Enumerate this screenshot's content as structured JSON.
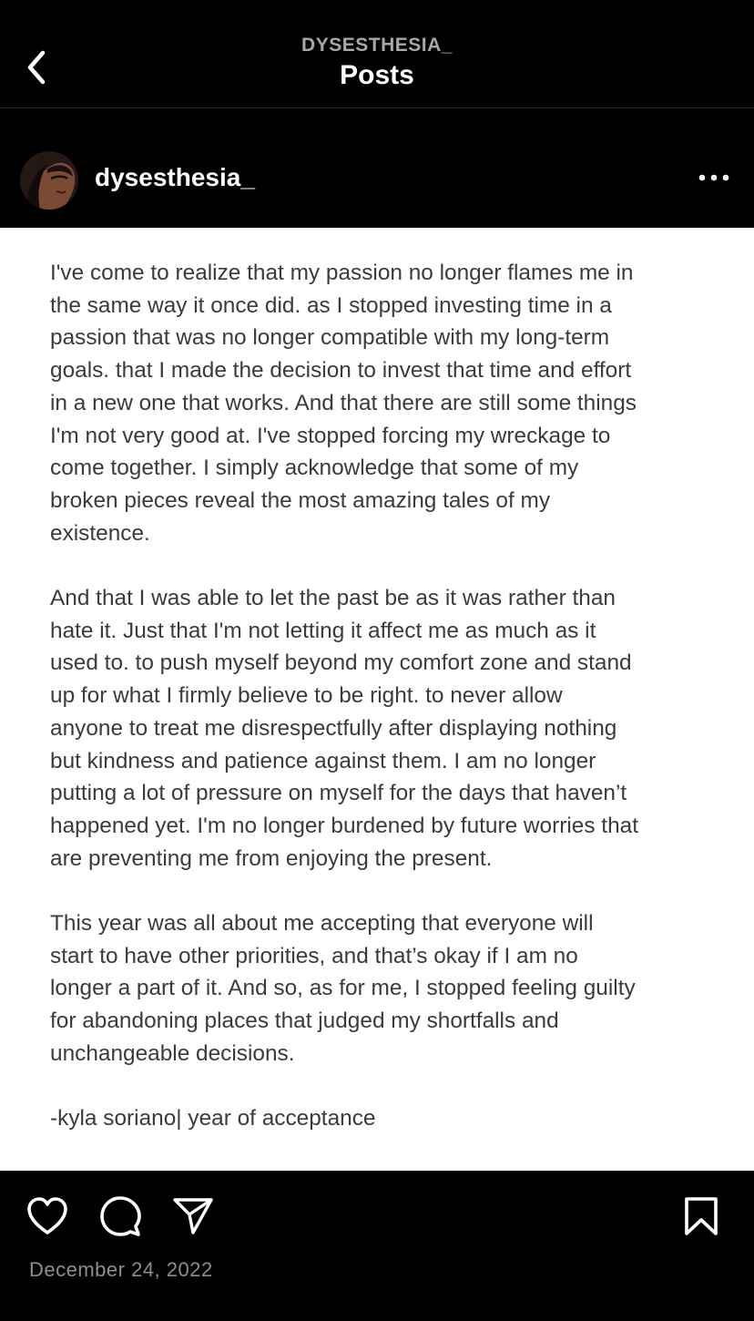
{
  "header": {
    "account_label": "DYSESTHESIA_",
    "title": "Posts",
    "back_icon": "chevron-left-icon"
  },
  "post": {
    "username": "dysesthesia_",
    "more_icon": "more-horizontal-icon",
    "paragraphs": [
      [
        "I've come to realize that my passion no longer flames me in",
        "the same way it once did. as I stopped investing time in a",
        "passion that was no longer compatible with my long-term",
        "goals. that I made the decision to invest that time and effort",
        "in a new one that works. And that there are still some things",
        "I'm not very good at. I've stopped forcing my wreckage to",
        "come together. I simply acknowledge that some of my",
        "broken pieces reveal the most amazing tales of my",
        "existence."
      ],
      [
        "And that I was able to let the past be as it was rather than",
        "hate it. Just that I'm not letting it affect me as much as it",
        "used to. to push myself beyond my comfort zone and stand",
        "up for what I firmly believe to be right. to never allow",
        "anyone to treat me disrespectfully after displaying nothing",
        "but kindness and patience against them. I am no longer",
        "putting a lot of pressure on myself for the days that haven’t",
        "happened yet. I'm no longer burdened by future worries that",
        "are preventing me from enjoying the present."
      ],
      [
        "This year was all about me accepting that everyone will",
        "start to have other priorities, and that’s okay if I am no",
        "longer a part of it. And so, as for me, I stopped feeling guilty",
        "for abandoning places that judged my shortfalls and",
        "unchangeable decisions."
      ],
      [
        "-kyla soriano| year of acceptance"
      ]
    ],
    "date": "December 24, 2022"
  },
  "actions": {
    "icons": [
      "heart-icon",
      "comment-icon",
      "send-icon",
      "bookmark-icon"
    ]
  },
  "colors": {
    "background": "#000000",
    "post_background": "#ffffff",
    "post_text": "#3b3b3b",
    "muted": "#8e8e8e"
  }
}
